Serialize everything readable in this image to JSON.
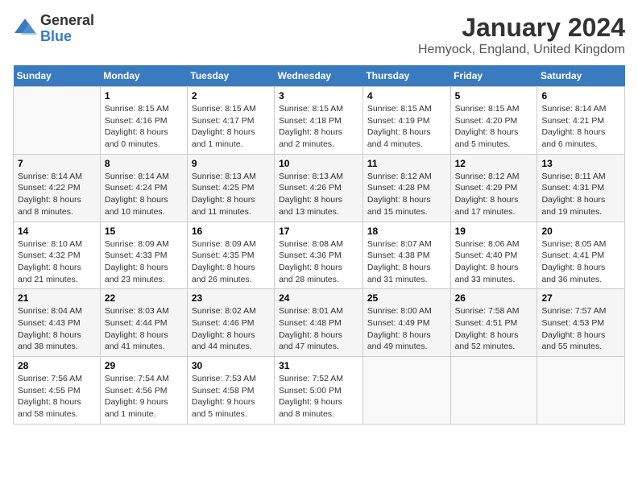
{
  "logo": {
    "general": "General",
    "blue": "Blue"
  },
  "title": "January 2024",
  "location": "Hemyock, England, United Kingdom",
  "days_of_week": [
    "Sunday",
    "Monday",
    "Tuesday",
    "Wednesday",
    "Thursday",
    "Friday",
    "Saturday"
  ],
  "weeks": [
    [
      {
        "day": "",
        "sunrise": "",
        "sunset": "",
        "daylight": ""
      },
      {
        "day": "1",
        "sunrise": "Sunrise: 8:15 AM",
        "sunset": "Sunset: 4:16 PM",
        "daylight": "Daylight: 8 hours and 0 minutes."
      },
      {
        "day": "2",
        "sunrise": "Sunrise: 8:15 AM",
        "sunset": "Sunset: 4:17 PM",
        "daylight": "Daylight: 8 hours and 1 minute."
      },
      {
        "day": "3",
        "sunrise": "Sunrise: 8:15 AM",
        "sunset": "Sunset: 4:18 PM",
        "daylight": "Daylight: 8 hours and 2 minutes."
      },
      {
        "day": "4",
        "sunrise": "Sunrise: 8:15 AM",
        "sunset": "Sunset: 4:19 PM",
        "daylight": "Daylight: 8 hours and 4 minutes."
      },
      {
        "day": "5",
        "sunrise": "Sunrise: 8:15 AM",
        "sunset": "Sunset: 4:20 PM",
        "daylight": "Daylight: 8 hours and 5 minutes."
      },
      {
        "day": "6",
        "sunrise": "Sunrise: 8:14 AM",
        "sunset": "Sunset: 4:21 PM",
        "daylight": "Daylight: 8 hours and 6 minutes."
      }
    ],
    [
      {
        "day": "7",
        "sunrise": "Sunrise: 8:14 AM",
        "sunset": "Sunset: 4:22 PM",
        "daylight": "Daylight: 8 hours and 8 minutes."
      },
      {
        "day": "8",
        "sunrise": "Sunrise: 8:14 AM",
        "sunset": "Sunset: 4:24 PM",
        "daylight": "Daylight: 8 hours and 10 minutes."
      },
      {
        "day": "9",
        "sunrise": "Sunrise: 8:13 AM",
        "sunset": "Sunset: 4:25 PM",
        "daylight": "Daylight: 8 hours and 11 minutes."
      },
      {
        "day": "10",
        "sunrise": "Sunrise: 8:13 AM",
        "sunset": "Sunset: 4:26 PM",
        "daylight": "Daylight: 8 hours and 13 minutes."
      },
      {
        "day": "11",
        "sunrise": "Sunrise: 8:12 AM",
        "sunset": "Sunset: 4:28 PM",
        "daylight": "Daylight: 8 hours and 15 minutes."
      },
      {
        "day": "12",
        "sunrise": "Sunrise: 8:12 AM",
        "sunset": "Sunset: 4:29 PM",
        "daylight": "Daylight: 8 hours and 17 minutes."
      },
      {
        "day": "13",
        "sunrise": "Sunrise: 8:11 AM",
        "sunset": "Sunset: 4:31 PM",
        "daylight": "Daylight: 8 hours and 19 minutes."
      }
    ],
    [
      {
        "day": "14",
        "sunrise": "Sunrise: 8:10 AM",
        "sunset": "Sunset: 4:32 PM",
        "daylight": "Daylight: 8 hours and 21 minutes."
      },
      {
        "day": "15",
        "sunrise": "Sunrise: 8:09 AM",
        "sunset": "Sunset: 4:33 PM",
        "daylight": "Daylight: 8 hours and 23 minutes."
      },
      {
        "day": "16",
        "sunrise": "Sunrise: 8:09 AM",
        "sunset": "Sunset: 4:35 PM",
        "daylight": "Daylight: 8 hours and 26 minutes."
      },
      {
        "day": "17",
        "sunrise": "Sunrise: 8:08 AM",
        "sunset": "Sunset: 4:36 PM",
        "daylight": "Daylight: 8 hours and 28 minutes."
      },
      {
        "day": "18",
        "sunrise": "Sunrise: 8:07 AM",
        "sunset": "Sunset: 4:38 PM",
        "daylight": "Daylight: 8 hours and 31 minutes."
      },
      {
        "day": "19",
        "sunrise": "Sunrise: 8:06 AM",
        "sunset": "Sunset: 4:40 PM",
        "daylight": "Daylight: 8 hours and 33 minutes."
      },
      {
        "day": "20",
        "sunrise": "Sunrise: 8:05 AM",
        "sunset": "Sunset: 4:41 PM",
        "daylight": "Daylight: 8 hours and 36 minutes."
      }
    ],
    [
      {
        "day": "21",
        "sunrise": "Sunrise: 8:04 AM",
        "sunset": "Sunset: 4:43 PM",
        "daylight": "Daylight: 8 hours and 38 minutes."
      },
      {
        "day": "22",
        "sunrise": "Sunrise: 8:03 AM",
        "sunset": "Sunset: 4:44 PM",
        "daylight": "Daylight: 8 hours and 41 minutes."
      },
      {
        "day": "23",
        "sunrise": "Sunrise: 8:02 AM",
        "sunset": "Sunset: 4:46 PM",
        "daylight": "Daylight: 8 hours and 44 minutes."
      },
      {
        "day": "24",
        "sunrise": "Sunrise: 8:01 AM",
        "sunset": "Sunset: 4:48 PM",
        "daylight": "Daylight: 8 hours and 47 minutes."
      },
      {
        "day": "25",
        "sunrise": "Sunrise: 8:00 AM",
        "sunset": "Sunset: 4:49 PM",
        "daylight": "Daylight: 8 hours and 49 minutes."
      },
      {
        "day": "26",
        "sunrise": "Sunrise: 7:58 AM",
        "sunset": "Sunset: 4:51 PM",
        "daylight": "Daylight: 8 hours and 52 minutes."
      },
      {
        "day": "27",
        "sunrise": "Sunrise: 7:57 AM",
        "sunset": "Sunset: 4:53 PM",
        "daylight": "Daylight: 8 hours and 55 minutes."
      }
    ],
    [
      {
        "day": "28",
        "sunrise": "Sunrise: 7:56 AM",
        "sunset": "Sunset: 4:55 PM",
        "daylight": "Daylight: 8 hours and 58 minutes."
      },
      {
        "day": "29",
        "sunrise": "Sunrise: 7:54 AM",
        "sunset": "Sunset: 4:56 PM",
        "daylight": "Daylight: 9 hours and 1 minute."
      },
      {
        "day": "30",
        "sunrise": "Sunrise: 7:53 AM",
        "sunset": "Sunset: 4:58 PM",
        "daylight": "Daylight: 9 hours and 5 minutes."
      },
      {
        "day": "31",
        "sunrise": "Sunrise: 7:52 AM",
        "sunset": "Sunset: 5:00 PM",
        "daylight": "Daylight: 9 hours and 8 minutes."
      },
      {
        "day": "",
        "sunrise": "",
        "sunset": "",
        "daylight": ""
      },
      {
        "day": "",
        "sunrise": "",
        "sunset": "",
        "daylight": ""
      },
      {
        "day": "",
        "sunrise": "",
        "sunset": "",
        "daylight": ""
      }
    ]
  ]
}
